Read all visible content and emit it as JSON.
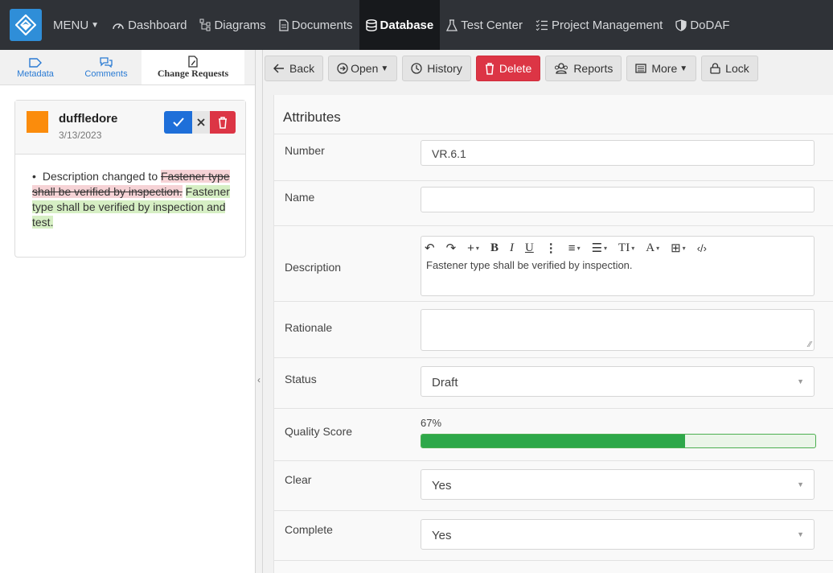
{
  "nav": {
    "menu": "MENU",
    "items": [
      {
        "label": "Dashboard",
        "icon": "gauge-icon"
      },
      {
        "label": "Diagrams",
        "icon": "diagram-icon"
      },
      {
        "label": "Documents",
        "icon": "document-icon"
      },
      {
        "label": "Database",
        "icon": "database-icon",
        "active": true
      },
      {
        "label": "Test Center",
        "icon": "flask-icon"
      },
      {
        "label": "Project Management",
        "icon": "tasks-icon"
      },
      {
        "label": "DoDAF",
        "icon": "shield-icon"
      }
    ]
  },
  "left": {
    "tabs": [
      {
        "label": "Metadata",
        "icon": "tag-icon"
      },
      {
        "label": "Comments",
        "icon": "comments-icon"
      },
      {
        "label": "Change Requests",
        "icon": "file-edit-icon",
        "active": true
      }
    ],
    "change_request": {
      "user": "duffledore",
      "date": "3/13/2023",
      "accent_color": "#fb8c0c",
      "prefix": "Description changed to ",
      "removed": "Fastener type shall be verified by inspection.",
      "added": "Fastener type shall be verified by inspection and test."
    }
  },
  "toolbar": {
    "back": "Back",
    "open": "Open",
    "history": "History",
    "delete": "Delete",
    "reports": "Reports",
    "more": "More",
    "lock": "Lock"
  },
  "form": {
    "title": "Attributes",
    "number_label": "Number",
    "number_value": "VR.6.1",
    "name_label": "Name",
    "name_value": "",
    "description_label": "Description",
    "description_value": "Fastener type shall be verified by inspection.",
    "rationale_label": "Rationale",
    "rationale_value": "",
    "status_label": "Status",
    "status_value": "Draft",
    "quality_label": "Quality Score",
    "quality_value": "67%",
    "quality_fraction": 0.67,
    "clear_label": "Clear",
    "clear_value": "Yes",
    "complete_label": "Complete",
    "complete_value": "Yes"
  },
  "colors": {
    "nav_bg": "#2f3237",
    "primary": "#1e6fd9",
    "danger": "#dc3545",
    "success": "#2ea84a"
  }
}
